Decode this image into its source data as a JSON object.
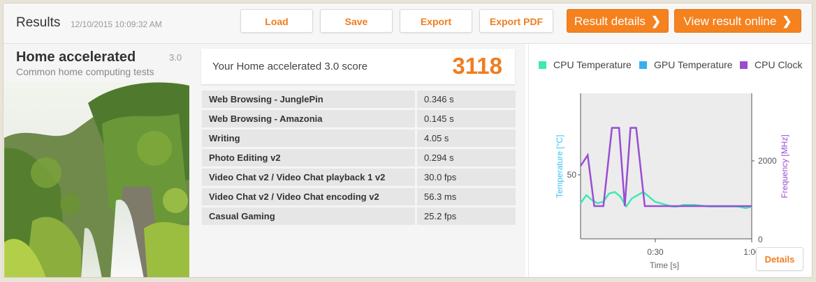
{
  "header": {
    "title": "Results",
    "timestamp": "12/10/2015 10:09:32 AM",
    "buttons": {
      "load": "Load",
      "save": "Save",
      "export": "Export",
      "export_pdf": "Export PDF",
      "result_details": "Result details",
      "view_online": "View result online"
    },
    "chevron": "❯"
  },
  "test": {
    "name": "Home accelerated",
    "version": "3.0",
    "description": "Common home computing tests",
    "image": "waterfall-landscape"
  },
  "score": {
    "label": "Your Home accelerated 3.0 score",
    "value": "3118"
  },
  "results": [
    {
      "name": "Web Browsing - JunglePin",
      "value": "0.346 s"
    },
    {
      "name": "Web Browsing - Amazonia",
      "value": "0.145 s"
    },
    {
      "name": "Writing",
      "value": "4.05 s"
    },
    {
      "name": "Photo Editing v2",
      "value": "0.294 s"
    },
    {
      "name": "Video Chat v2 / Video Chat playback 1 v2",
      "value": "30.0 fps"
    },
    {
      "name": "Video Chat v2 / Video Chat encoding v2",
      "value": "56.3 ms"
    },
    {
      "name": "Casual Gaming",
      "value": "25.2 fps"
    }
  ],
  "monitor": {
    "legend": [
      "CPU Temperature",
      "GPU Temperature",
      "CPU Clock"
    ],
    "colors": {
      "cpu_temp": "#3de8b4",
      "gpu_temp": "#3aaef0",
      "cpu_clock": "#9a4dd2",
      "accent": "#f5821f"
    },
    "left_axis_label": "Temperature [°C]",
    "right_axis_label": "Frequency [MHz]",
    "x_label": "Time [s]",
    "left_ticks": [
      "50"
    ],
    "right_ticks": [
      "2000",
      "0"
    ],
    "x_ticks": [
      "0:30",
      "1:00"
    ],
    "details_label": "Details"
  },
  "chart_data": {
    "type": "line",
    "xlabel": "Time [s]",
    "ylabel": "Temperature [°C]",
    "y2label": "Frequency [MHz]",
    "xlim": [
      0,
      60
    ],
    "ylim": [
      20,
      110
    ],
    "y2lim": [
      0,
      4000
    ],
    "series": [
      {
        "name": "CPU Temperature",
        "axis": "left",
        "x": [
          0,
          2,
          4,
          6,
          8,
          10,
          12,
          14,
          16,
          18,
          20,
          22,
          24,
          26,
          28,
          30,
          32,
          34,
          36,
          38,
          40,
          45,
          50,
          55,
          58,
          60
        ],
        "values": [
          42,
          47,
          44,
          42,
          43,
          48,
          49,
          46,
          40,
          45,
          47,
          49,
          46,
          43,
          42,
          41,
          40,
          40,
          41,
          41,
          41,
          40,
          40,
          40,
          39,
          40
        ]
      },
      {
        "name": "CPU Clock",
        "axis": "right",
        "x": [
          0,
          2.5,
          4.8,
          8,
          11,
          13.5,
          15.5,
          17.5,
          19.5,
          22.5,
          25.5,
          60
        ],
        "values": [
          2000,
          2300,
          900,
          900,
          3050,
          3050,
          900,
          3050,
          3050,
          900,
          900,
          900
        ]
      }
    ]
  }
}
